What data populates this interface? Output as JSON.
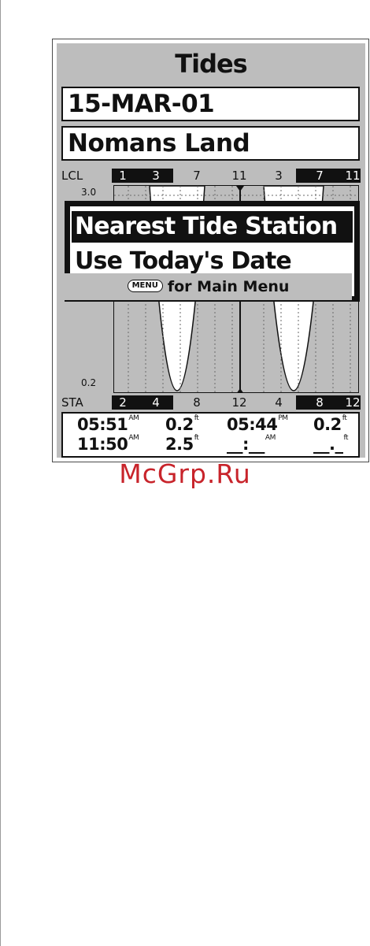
{
  "screen": {
    "title": "Tides",
    "date": "15-MAR-01",
    "station": "Nomans Land"
  },
  "lcl_row": {
    "label": "LCL",
    "hours": [
      "1",
      "3",
      "7",
      "11",
      "3",
      "7",
      "11"
    ]
  },
  "sta_row": {
    "label": "STA",
    "hours": [
      "2",
      "4",
      "8",
      "12",
      "4",
      "8",
      "12"
    ]
  },
  "chart": {
    "y_max_label": "3.0",
    "y_min_label": "0.2",
    "unit": "ft"
  },
  "menu": {
    "options": [
      "Nearest Tide Station",
      "Use Today's Date"
    ],
    "selected_index": 0,
    "footer_key": "MENU",
    "footer_text": "for Main Menu"
  },
  "tide_table": {
    "rows": [
      [
        {
          "time": "05:51",
          "ampm": "AM",
          "height": "0.2",
          "unit": "ft"
        },
        {
          "time": "05:44",
          "ampm": "PM",
          "height": "0.2",
          "unit": "ft"
        }
      ],
      [
        {
          "time": "11:50",
          "ampm": "AM",
          "height": "2.5",
          "unit": "ft"
        },
        {
          "time": "__:__",
          "ampm": "AM",
          "height": "__._",
          "unit": "ft"
        }
      ]
    ]
  },
  "watermark": "McGrp.Ru",
  "colors": {
    "screen_bg": "#bdbdbd",
    "ink": "#111111",
    "watermark": "#c8242b"
  }
}
